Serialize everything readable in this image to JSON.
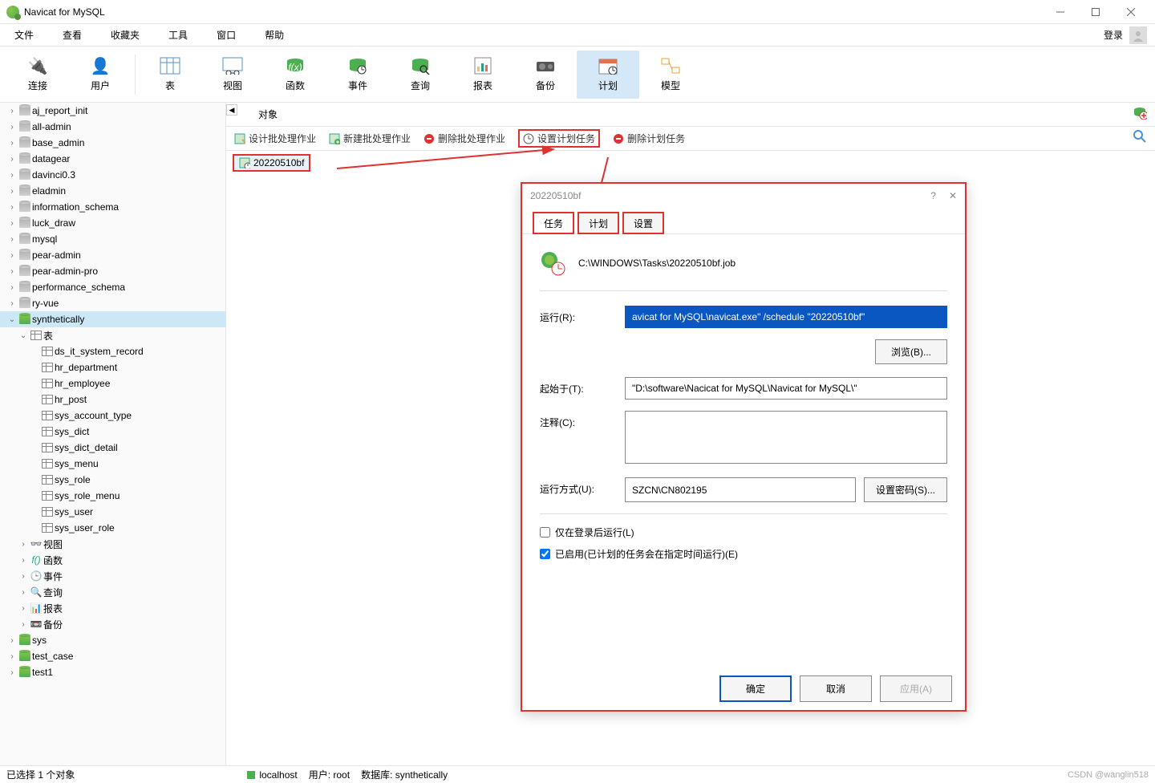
{
  "app_title": "Navicat for MySQL",
  "menu": {
    "file": "文件",
    "view": "查看",
    "fav": "收藏夹",
    "tools": "工具",
    "window": "窗口",
    "help": "帮助",
    "login": "登录"
  },
  "toolbar": {
    "connect": "连接",
    "user": "用户",
    "table": "表",
    "view": "视图",
    "func": "函数",
    "event": "事件",
    "query": "查询",
    "report": "报表",
    "backup": "备份",
    "schedule": "计划",
    "model": "模型"
  },
  "sidebar": {
    "databases": [
      "aj_report_init",
      "all-admin",
      "base_admin",
      "datagear",
      "davinci0.3",
      "eladmin",
      "information_schema",
      "luck_draw",
      "mysql",
      "pear-admin",
      "pear-admin-pro",
      "performance_schema",
      "ry-vue"
    ],
    "db_active": "synthetically",
    "group_tables": "表",
    "tables": [
      "ds_it_system_record",
      "hr_department",
      "hr_employee",
      "hr_post",
      "sys_account_type",
      "sys_dict",
      "sys_dict_detail",
      "sys_menu",
      "sys_role",
      "sys_role_menu",
      "sys_user",
      "sys_user_role"
    ],
    "groups": {
      "views": "视图",
      "funcs": "函数",
      "events": "事件",
      "queries": "查询",
      "reports": "报表",
      "backups": "备份"
    },
    "db_tail": [
      "sys",
      "test_case",
      "test1"
    ]
  },
  "content": {
    "tab_objects": "对象",
    "actions": {
      "design": "设计批处理作业",
      "new": "新建批处理作业",
      "deljob": "删除批处理作业",
      "settask": "设置计划任务",
      "deltask": "删除计划任务"
    },
    "item": "20220510bf"
  },
  "dialog": {
    "title": "20220510bf",
    "tabs": {
      "task": "任务",
      "schedule": "计划",
      "settings": "设置"
    },
    "path": "C:\\WINDOWS\\Tasks\\20220510bf.job",
    "labels": {
      "run": "运行(R):",
      "browse": "浏览(B)...",
      "start_in": "起始于(T):",
      "comment": "注释(C):",
      "run_as": "运行方式(U):",
      "set_pwd": "设置密码(S)...",
      "only_logon": "仅在登录后运行(L)",
      "enabled": "已启用(已计划的任务会在指定时间运行)(E)",
      "ok": "确定",
      "cancel": "取消",
      "apply": "应用(A)"
    },
    "values": {
      "run": "avicat for MySQL\\navicat.exe\" /schedule \"20220510bf\"",
      "start_in": "\"D:\\software\\Nacicat for MySQL\\Navicat for MySQL\\\"",
      "run_as": "SZCN\\CN802195"
    }
  },
  "status": {
    "selected": "已选择 1 个对象",
    "host": "localhost",
    "user": "用户: root",
    "db": "数据库: synthetically"
  },
  "watermark": "CSDN @wanglin518"
}
